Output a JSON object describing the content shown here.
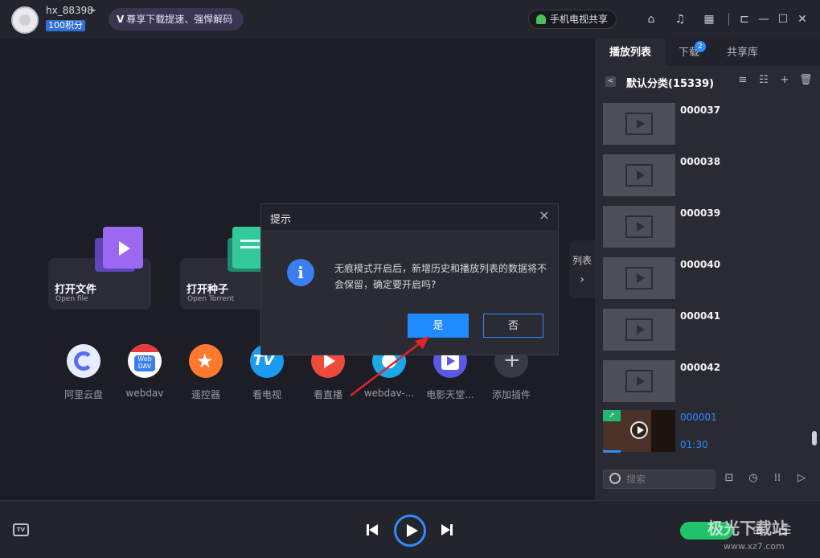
{
  "topbar": {
    "username": "hx_88398",
    "points": "100积分",
    "vip_banner": "尊享下载提速、强悍解码",
    "vip_mark": "V",
    "tv_share": "手机电视共享"
  },
  "main": {
    "cards": [
      {
        "title": "打开文件",
        "subtitle": "Open file"
      },
      {
        "title": "打开种子",
        "subtitle": "Open Torrent"
      }
    ],
    "plugins": [
      {
        "label": "阿里云盘",
        "icon": "aliyun-drive-icon"
      },
      {
        "label": "webdav",
        "icon": "webdav-icon"
      },
      {
        "label": "遥控器",
        "icon": "remote-control-icon"
      },
      {
        "label": "看电视",
        "icon": "tv-icon"
      },
      {
        "label": "看直播",
        "icon": "live-icon"
      },
      {
        "label": "webdav-...",
        "icon": "webdav2-icon"
      },
      {
        "label": "电影天堂...",
        "icon": "movie-heaven-icon"
      },
      {
        "label": "添加插件",
        "icon": "plus-icon"
      }
    ],
    "webdav_logo": "Web\nDAV",
    "tv_logo": "TV",
    "side_tab": "列表",
    "side_tab_arrow": "›"
  },
  "dialog": {
    "title": "提示",
    "message": "无痕模式开启后，新增历史和播放列表的数据将不会保留，确定要开启吗?",
    "yes": "是",
    "no": "否",
    "close": "×",
    "info_glyph": "i"
  },
  "panel": {
    "tabs": [
      "播放列表",
      "下载",
      "共享库"
    ],
    "download_badge": "2",
    "list_title": "默认分类(15339)",
    "back_glyph": "<",
    "items": [
      {
        "name": "000037"
      },
      {
        "name": "000038"
      },
      {
        "name": "000039"
      },
      {
        "name": "000040"
      },
      {
        "name": "000041"
      },
      {
        "name": "000042"
      }
    ],
    "playing": {
      "name": "000001",
      "time": "01:30"
    },
    "search_placeholder": "搜索"
  },
  "player": {
    "tv_label": "TV"
  },
  "watermark": {
    "text": "极光下载站",
    "url": "www.xz7.com"
  },
  "colors": {
    "accent": "#2f8bff",
    "background": "#1d1d25",
    "panel": "#2a2a33"
  }
}
